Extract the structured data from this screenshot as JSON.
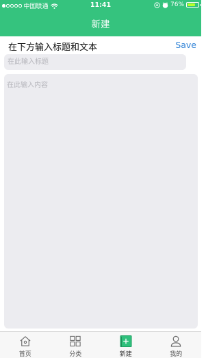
{
  "status_bar": {
    "carrier": "中国联通",
    "time": "11:41",
    "battery_percent": "76%",
    "battery_level": 0.76
  },
  "nav": {
    "title": "新建"
  },
  "header": {
    "hint": "在下方输入标题和文本",
    "save_label": "Save"
  },
  "title_input": {
    "placeholder": "在此输入标题",
    "value": ""
  },
  "content_input": {
    "placeholder": "在此输入内容",
    "value": ""
  },
  "tabs": [
    {
      "label": "首页",
      "icon": "home-icon"
    },
    {
      "label": "分类",
      "icon": "grid-icon"
    },
    {
      "label": "新建",
      "icon": "new-note-icon"
    },
    {
      "label": "我的",
      "icon": "profile-icon"
    }
  ],
  "colors": {
    "accent": "#35c37e",
    "link": "#2f82d6",
    "input_bg": "#ececf0"
  }
}
